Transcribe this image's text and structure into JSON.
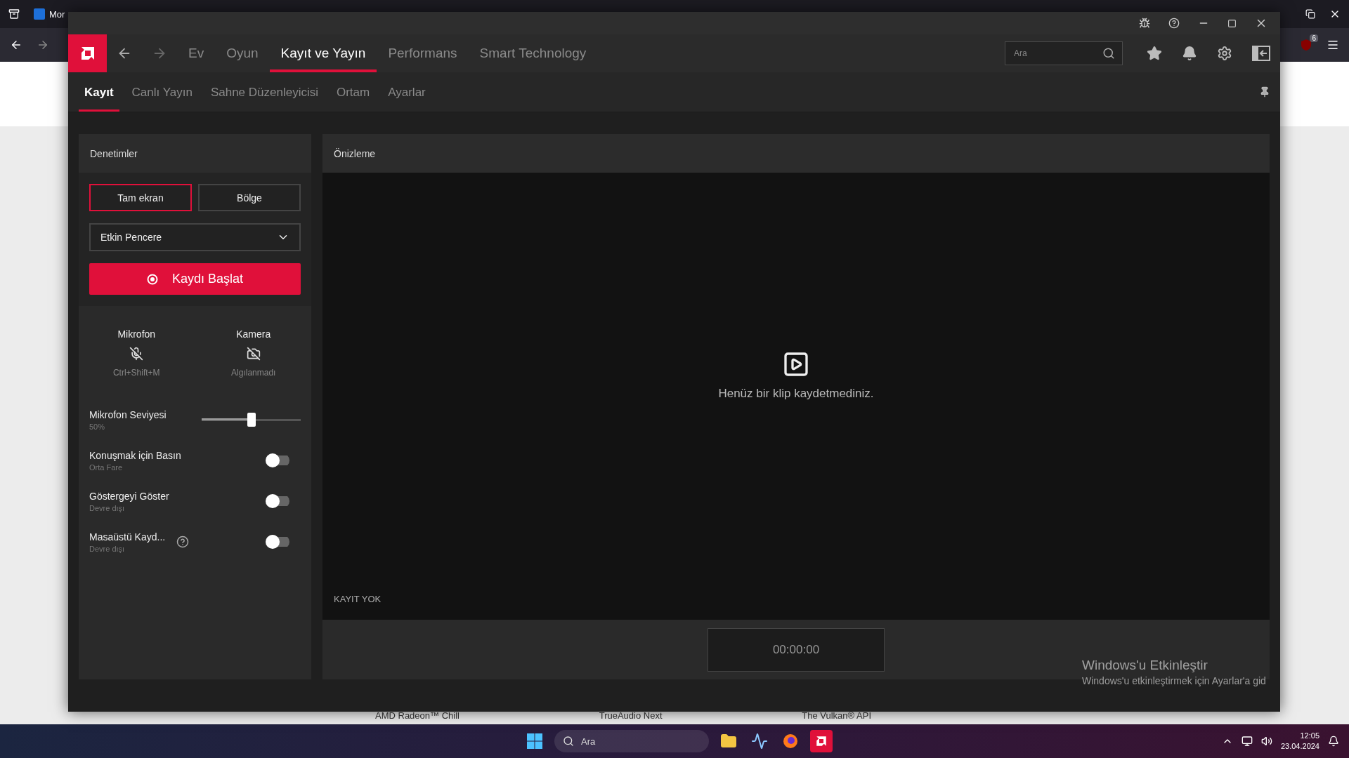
{
  "browser": {
    "tab_title": "Mor",
    "extension_badge": "6",
    "page_texts": [
      "AMD Radeon™ Chill",
      "TrueAudio Next",
      "The Vulkan® API"
    ]
  },
  "app": {
    "nav": [
      {
        "label": "Ev",
        "selected": false
      },
      {
        "label": "Oyun",
        "selected": false
      },
      {
        "label": "Kayıt ve Yayın",
        "selected": true
      },
      {
        "label": "Performans",
        "selected": false
      },
      {
        "label": "Smart Technology",
        "selected": false
      }
    ],
    "search": {
      "placeholder": "Ara"
    },
    "subtabs": [
      {
        "label": "Kayıt",
        "selected": true
      },
      {
        "label": "Canlı Yayın",
        "selected": false
      },
      {
        "label": "Sahne Düzenleyicisi",
        "selected": false
      },
      {
        "label": "Ortam",
        "selected": false
      },
      {
        "label": "Ayarlar",
        "selected": false
      }
    ],
    "controls": {
      "title": "Denetimler",
      "modes": [
        {
          "label": "Tam ekran",
          "selected": true
        },
        {
          "label": "Bölge",
          "selected": false
        }
      ],
      "capture_select": "Etkin Pencere",
      "record_button": "Kaydı Başlat",
      "devices": [
        {
          "kind": "mic",
          "label": "Mikrofon",
          "caption": "Ctrl+Shift+M"
        },
        {
          "kind": "camera",
          "label": "Kamera",
          "caption": "Algılanmadı"
        }
      ],
      "settings": [
        {
          "kind": "slider",
          "label": "Mikrofon Seviyesi",
          "caption": "50%",
          "level": 0.5,
          "help": false
        },
        {
          "kind": "toggle",
          "label": "Konuşmak için Basın",
          "caption": "Orta Fare",
          "on": false,
          "help": false
        },
        {
          "kind": "toggle",
          "label": "Göstergeyi Göster",
          "caption": "Devre dışı",
          "on": false,
          "help": false
        },
        {
          "kind": "toggle",
          "label": "Masaüstü Kayd...",
          "caption": "Devre dışı",
          "on": false,
          "help": true
        }
      ]
    },
    "preview": {
      "title": "Önizleme",
      "message": "Henüz bir klip kaydetmediniz.",
      "status": "KAYIT YOK",
      "timer": "00:00:00"
    }
  },
  "activation": {
    "title": "Windows'u Etkinleştir",
    "text": "Windows'u etkinleştirmek için Ayarlar'a gid"
  },
  "taskbar": {
    "search_placeholder": "Ara",
    "time": "12:05",
    "date": "23.04.2024"
  }
}
